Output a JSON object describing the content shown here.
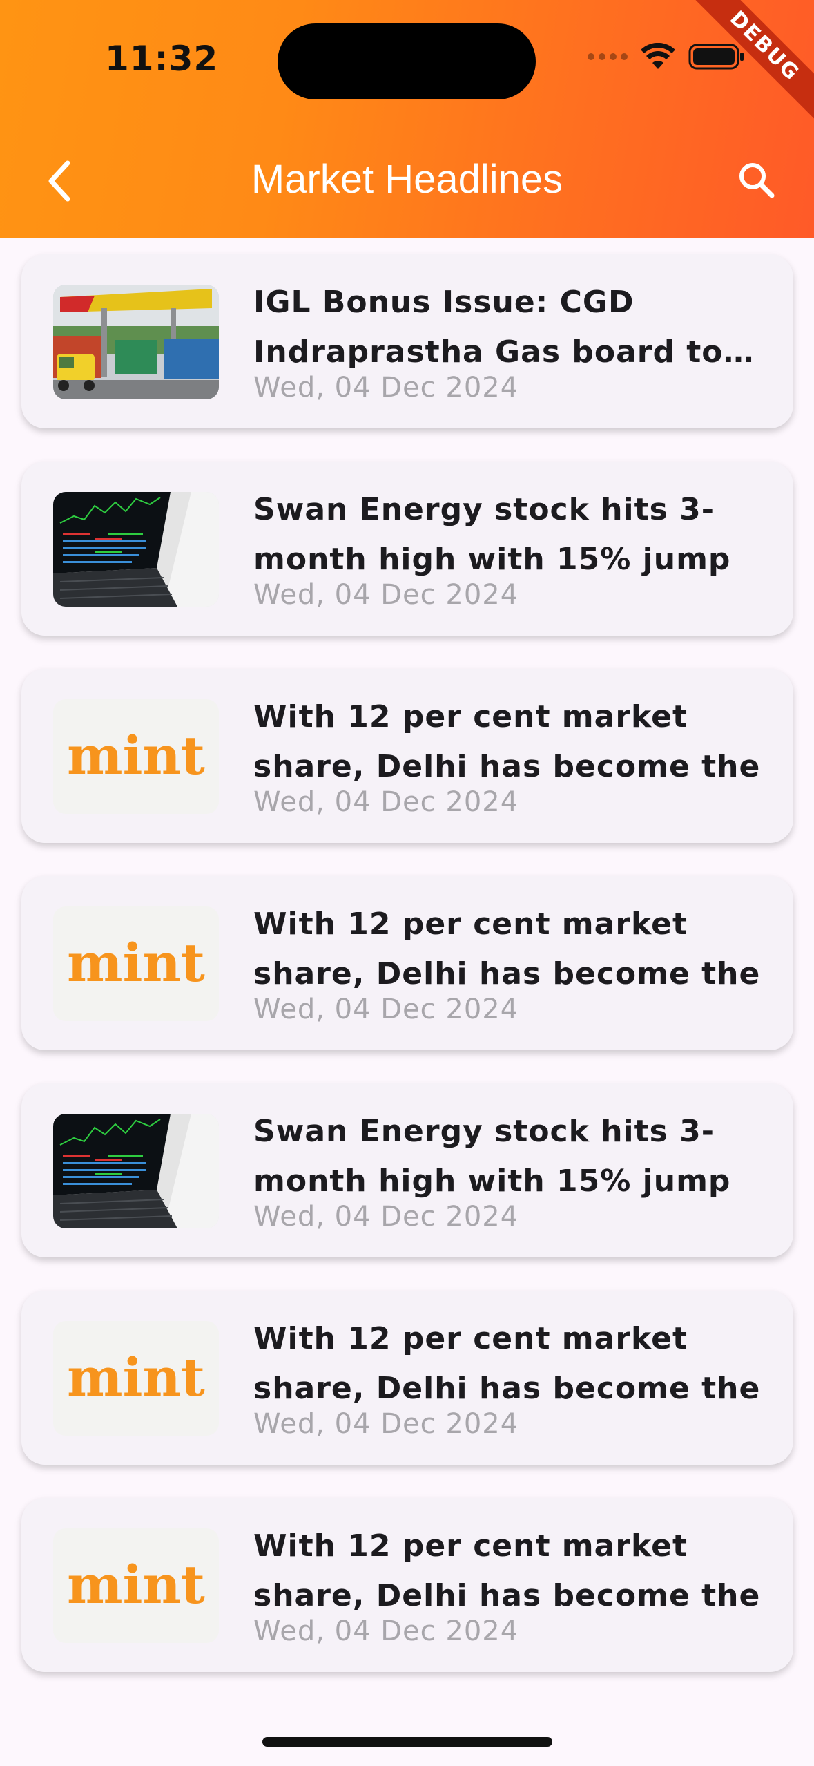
{
  "status_bar": {
    "time": "11:32",
    "debug_label": "DEBUG"
  },
  "header": {
    "title": "Market Headlines",
    "back_icon": "chevron-left-icon",
    "search_icon": "search-icon"
  },
  "colors": {
    "header_gradient_start": "#ff9413",
    "header_gradient_end": "#ff5a28",
    "card_background": "#f6f2f8",
    "title_text": "#1c1b1f",
    "date_text": "#a8a6ab",
    "mint_brand": "#f7941d"
  },
  "mint_logo_text": "mint",
  "articles": [
    {
      "thumbnail": "igl-gas-station",
      "title": "IGL Bonus Issue: CGD Indraprastha Gas board to consider bonus issue",
      "date": "Wed, 04 Dec 2024"
    },
    {
      "thumbnail": "stock-laptop",
      "title": "Swan Energy stock hits 3-month high with 15% jump",
      "date": "Wed, 04 Dec 2024"
    },
    {
      "thumbnail": "mint-logo",
      "title": "With 12 per cent market share, Delhi has become the",
      "date": "Wed, 04 Dec 2024"
    },
    {
      "thumbnail": "mint-logo",
      "title": "With 12 per cent market share, Delhi has become the",
      "date": "Wed, 04 Dec 2024"
    },
    {
      "thumbnail": "stock-laptop",
      "title": "Swan Energy stock hits 3-month high with 15% jump",
      "date": "Wed, 04 Dec 2024"
    },
    {
      "thumbnail": "mint-logo",
      "title": "With 12 per cent market share, Delhi has become the",
      "date": "Wed, 04 Dec 2024"
    },
    {
      "thumbnail": "mint-logo",
      "title": "With 12 per cent market share, Delhi has become the",
      "date": "Wed, 04 Dec 2024"
    }
  ]
}
